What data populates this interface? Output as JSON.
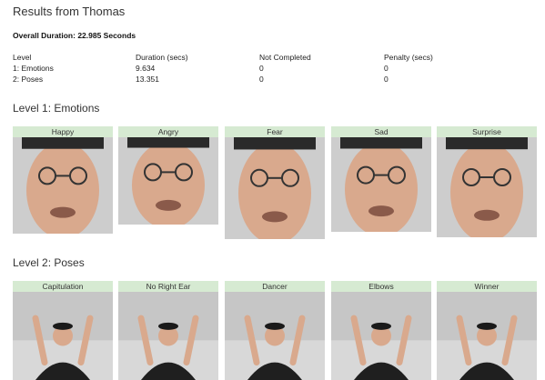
{
  "title": "Results from Thomas",
  "overall_duration": "Overall Duration: 22.985 Seconds",
  "table": {
    "headers": [
      "Level",
      "Duration (secs)",
      "Not Completed",
      "Penalty (secs)"
    ],
    "rows": [
      [
        "1: Emotions",
        "9.634",
        "0",
        "0"
      ],
      [
        "2: Poses",
        "13.351",
        "0",
        "0"
      ]
    ]
  },
  "levels": [
    {
      "title": "Level 1: Emotions",
      "cards": [
        {
          "label": "Happy",
          "icon": "face-photo"
        },
        {
          "label": "Angry",
          "icon": "face-photo"
        },
        {
          "label": "Fear",
          "icon": "face-photo"
        },
        {
          "label": "Sad",
          "icon": "face-photo"
        },
        {
          "label": "Surprise",
          "icon": "face-photo"
        }
      ]
    },
    {
      "title": "Level 2: Poses",
      "cards": [
        {
          "label": "Capitulation",
          "icon": "pose-photo"
        },
        {
          "label": "No Right Ear",
          "icon": "pose-photo"
        },
        {
          "label": "Dancer",
          "icon": "pose-photo"
        },
        {
          "label": "Elbows",
          "icon": "pose-photo"
        },
        {
          "label": "Winner",
          "icon": "pose-photo"
        }
      ]
    }
  ],
  "colors": {
    "label_bg": "#d6ead2",
    "face_bg": "#cdcdcd",
    "pose_bg": "#c6c6c6",
    "skin": "#d9a98d",
    "shirt": "#1f1f1f"
  }
}
